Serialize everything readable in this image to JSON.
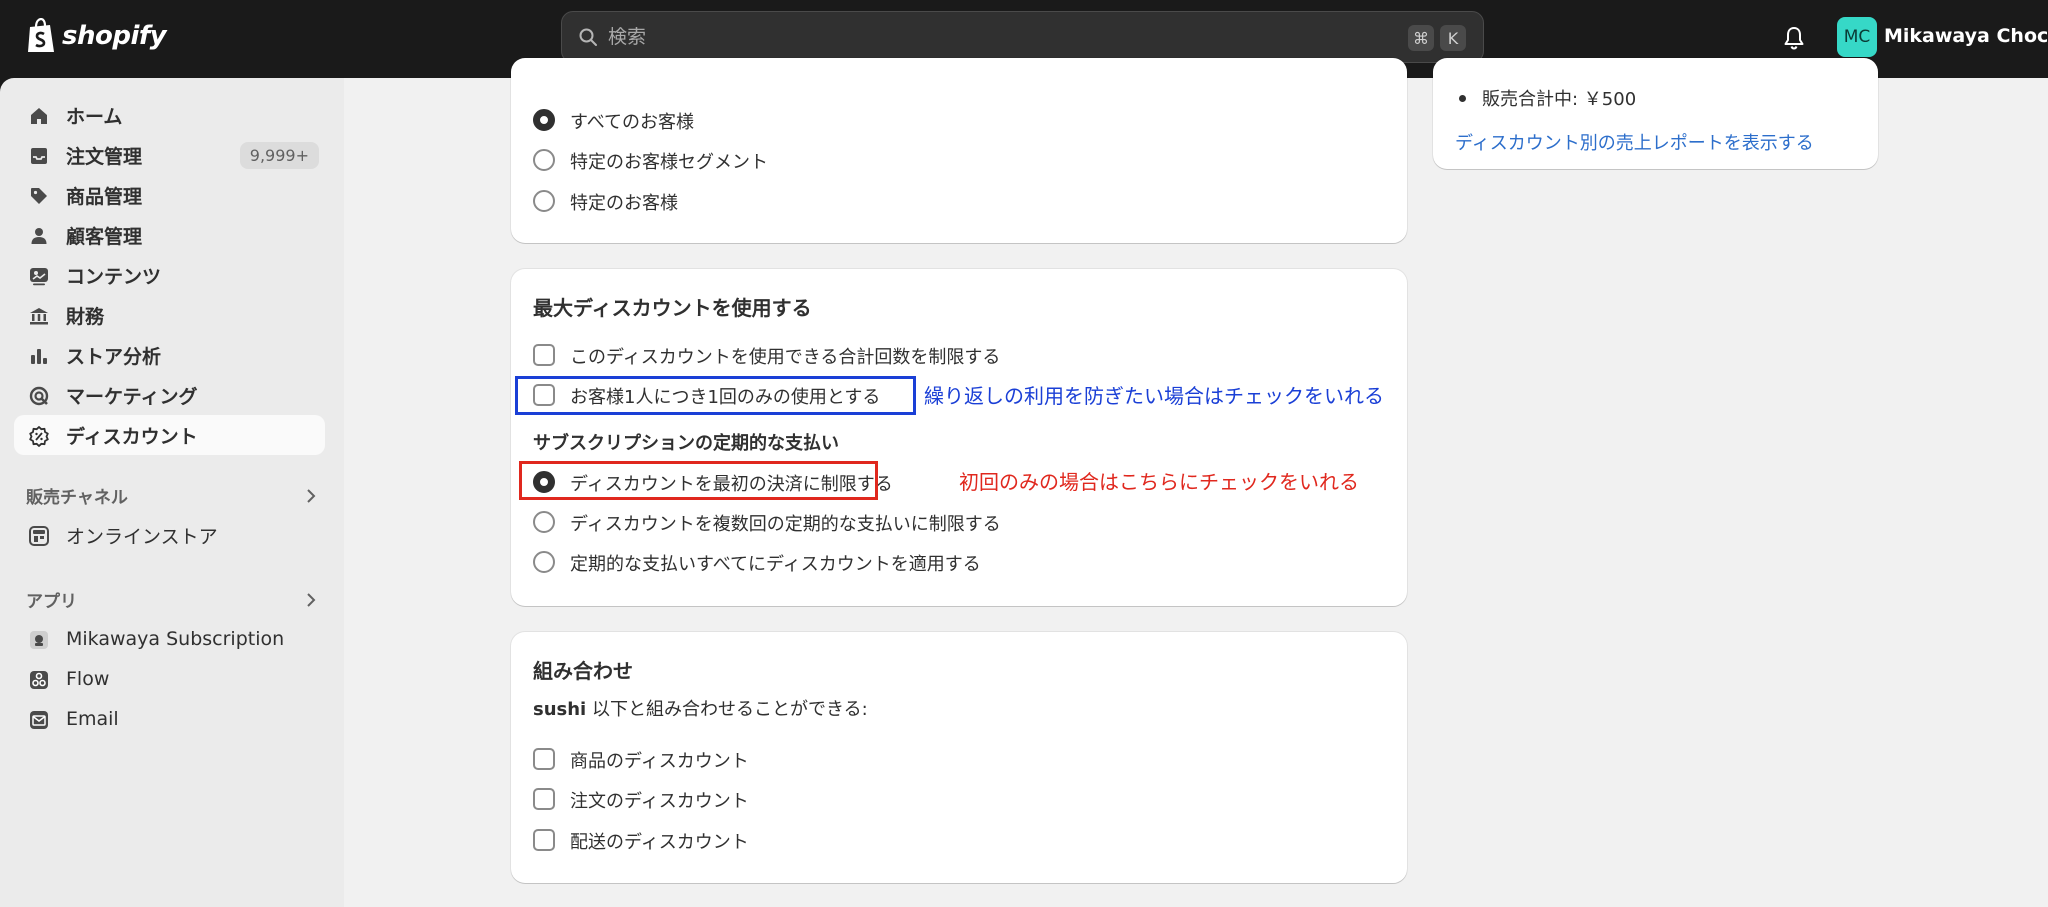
{
  "topbar": {
    "logo_text": "shopify",
    "search_placeholder": "検索",
    "shortcut_cmd": "⌘",
    "shortcut_key": "K",
    "avatar_initials": "MC",
    "store_name": "Mikawaya Choco"
  },
  "sidebar": {
    "items": [
      {
        "label": "ホーム",
        "icon": "home-icon"
      },
      {
        "label": "注文管理",
        "icon": "inbox-icon",
        "badge": "9,999+"
      },
      {
        "label": "商品管理",
        "icon": "tag-icon"
      },
      {
        "label": "顧客管理",
        "icon": "person-icon"
      },
      {
        "label": "コンテンツ",
        "icon": "content-icon"
      },
      {
        "label": "財務",
        "icon": "bank-icon"
      },
      {
        "label": "ストア分析",
        "icon": "bar-chart-icon"
      },
      {
        "label": "マーケティング",
        "icon": "target-icon"
      },
      {
        "label": "ディスカウント",
        "icon": "discount-icon",
        "active": true
      }
    ],
    "sales_channels_title": "販売チャネル",
    "online_store_label": "オンラインストア",
    "apps_title": "アプリ",
    "apps": [
      {
        "label": "Mikawaya Subscription",
        "icon": "app-icon"
      },
      {
        "label": "Flow",
        "icon": "flow-icon"
      },
      {
        "label": "Email",
        "icon": "email-icon"
      }
    ]
  },
  "eligibility": {
    "options": [
      "すべてのお客様",
      "特定のお客様セグメント",
      "特定のお客様"
    ],
    "selected": "すべてのお客様"
  },
  "summary": {
    "bullet": "販売合計中: ￥500",
    "report_link": "ディスカウント別の売上レポートを表示する"
  },
  "max_uses": {
    "title": "最大ディスカウントを使用する",
    "limit_total": "このディスカウントを使用できる合計回数を制限する",
    "limit_per_customer": "お客様1人につき1回のみの使用とする",
    "subscription_title": "サブスクリプションの定期的な支払い",
    "subscription_options": [
      "ディスカウントを最初の決済に制限する",
      "ディスカウントを複数回の定期的な支払いに制限する",
      "定期的な支払いすべてにディスカウントを適用する"
    ],
    "subscription_selected": "ディスカウントを最初の決済に制限する"
  },
  "combinations": {
    "title": "組み合わせ",
    "code": "sushi",
    "description": " 以下と組み合わせることができる:",
    "options": [
      "商品のディスカウント",
      "注文のディスカウント",
      "配送のディスカウント"
    ]
  },
  "annotations": {
    "blue_text": "繰り返しの利用を防ぎたい場合はチェックをいれる",
    "red_text": "初回のみの場合はこちらにチェックをいれる",
    "blue_color": "#1a3fd6",
    "red_color": "#e0281e"
  }
}
